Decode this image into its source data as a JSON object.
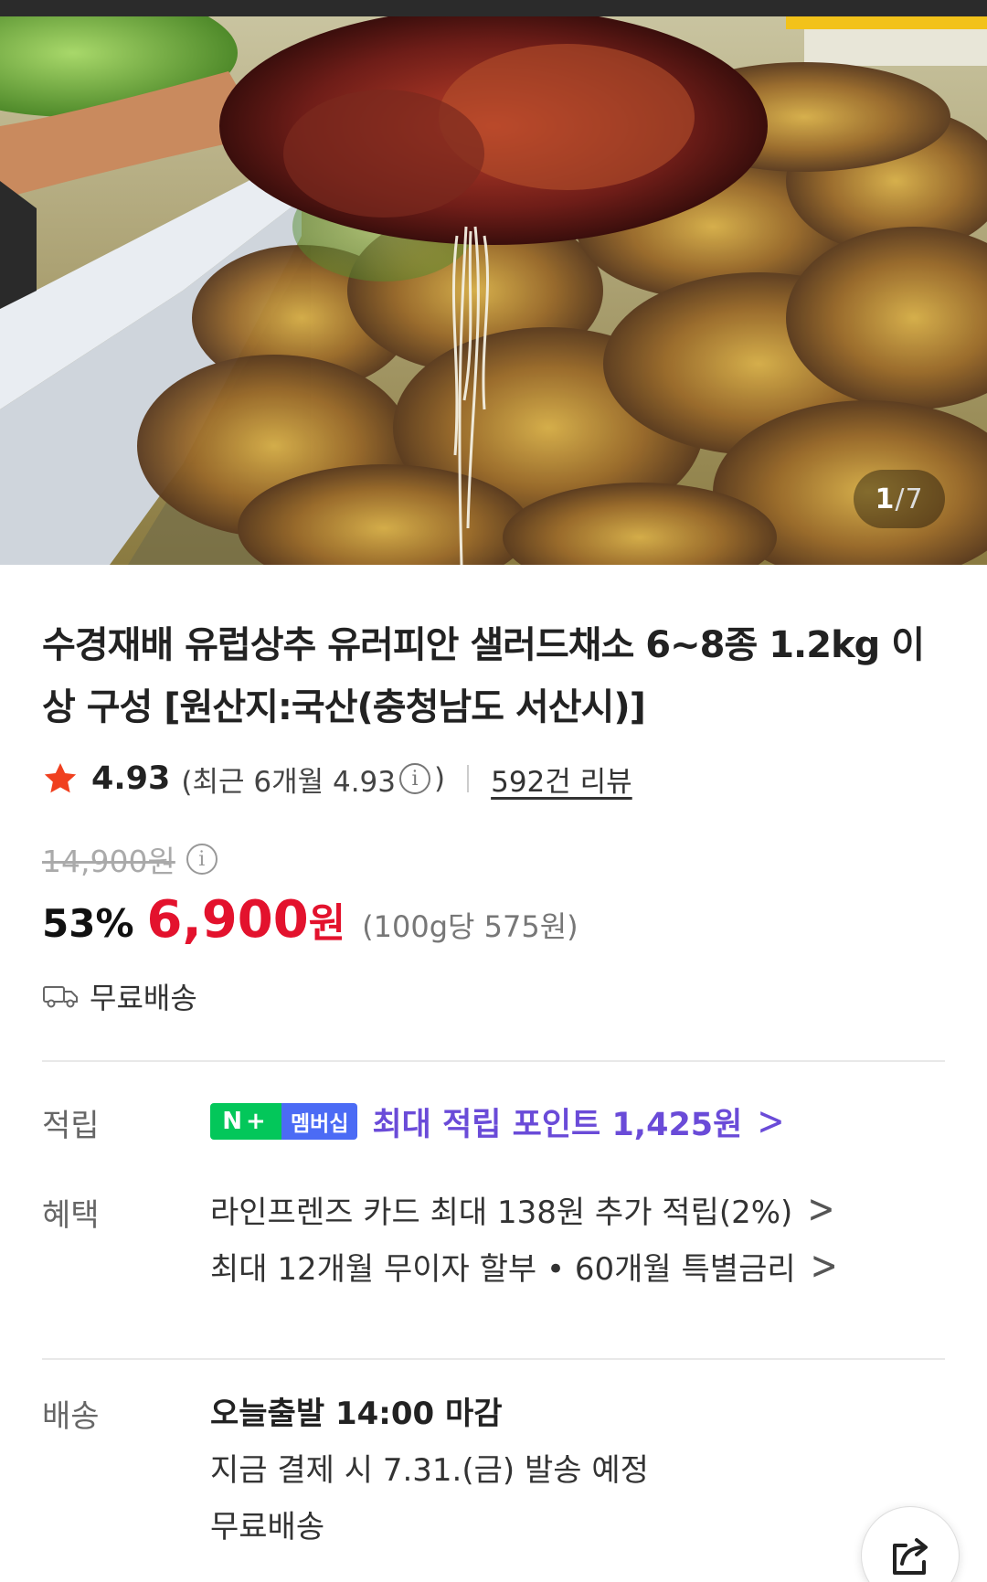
{
  "gallery": {
    "current": "1",
    "separator": "/",
    "total": "7"
  },
  "product": {
    "title": "수경재배 유럽상추 유러피안 샐러드채소 6~8종 1.2kg 이상 구성 [원산지:국산(충청남도 서산시)]"
  },
  "rating": {
    "score": "4.93",
    "recent_prefix": "(최근 6개월 4.93",
    "recent_suffix": ")",
    "info_glyph": "i",
    "reviews": "592건 리뷰"
  },
  "price": {
    "original": "14,900원",
    "discount": "53%",
    "current": "6,900",
    "currency": "원",
    "unit_price": "(100g당 575원)",
    "info_glyph": "i"
  },
  "shipping_summary": "무료배송",
  "points_row": {
    "label": "적립",
    "badge_n": "N+",
    "badge_membership": "멤버십",
    "text": "최대 적립 포인트 1,425원",
    "chevron": ">"
  },
  "benefits_row": {
    "label": "혜택",
    "items": [
      {
        "text": "라인프렌즈 카드 최대 138원 추가 적립(2%)",
        "chevron": ">"
      },
      {
        "text": "최대 12개월 무이자 할부 • 60개월 특별금리",
        "chevron": ">"
      }
    ]
  },
  "delivery_row": {
    "label": "배송",
    "headline": "오늘출발 14:00 마감",
    "schedule": "지금 결제 시 7.31.(금) 발송 예정",
    "fee": "무료배송"
  },
  "icons": {
    "rating": "star-icon",
    "shipping": "truck-icon",
    "share": "share-icon",
    "info": "info-icon"
  },
  "colors": {
    "sale_red": "#e3122d",
    "star": "#f0401f",
    "naver_green": "#03c75a",
    "membership_blue": "#4b6bf5",
    "points_purple": "#6a4bd8"
  }
}
